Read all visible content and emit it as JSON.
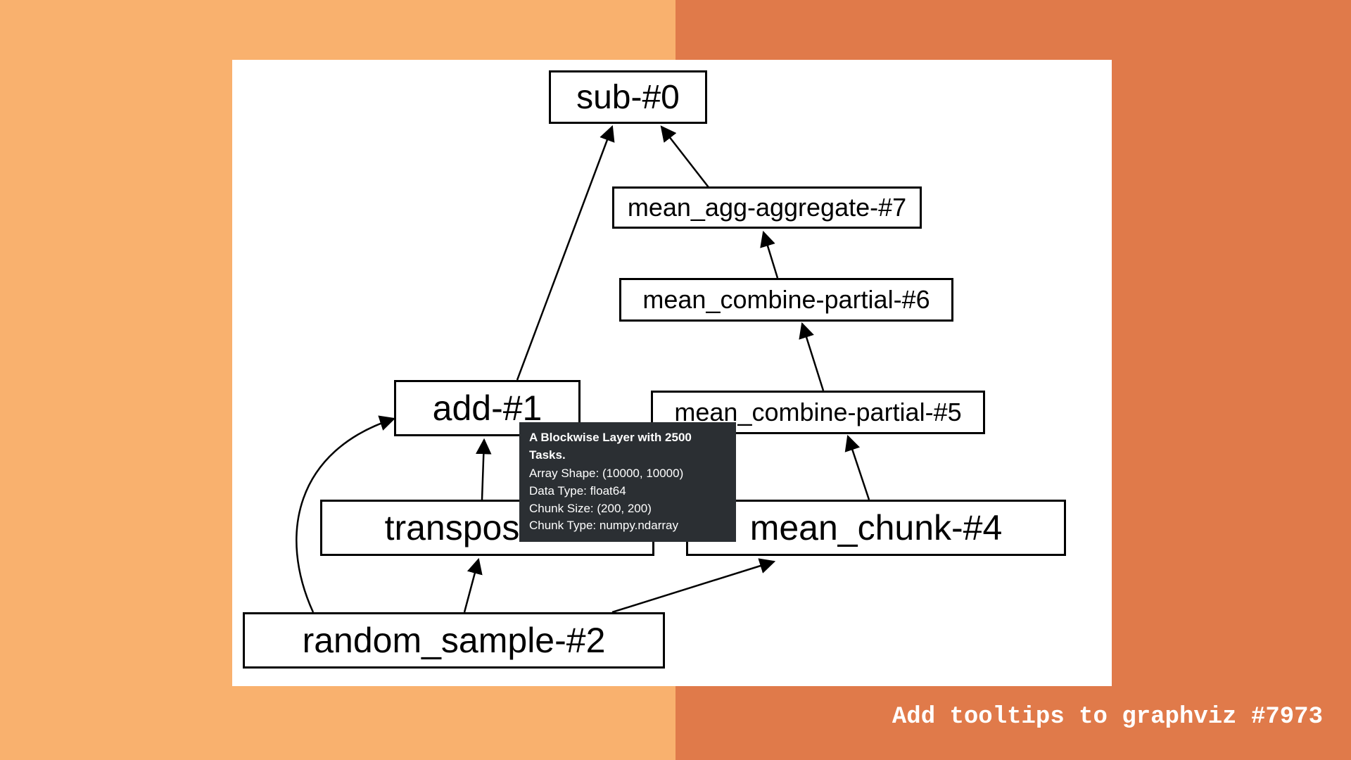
{
  "slide": {
    "background_left_color": "#f9b16e",
    "background_right_color": "#e07a4a",
    "caption": "Add tooltips to graphviz #7973"
  },
  "graph": {
    "nodes": {
      "sub": {
        "label": "sub-#0"
      },
      "aggregate": {
        "label": "mean_agg-aggregate-#7"
      },
      "partial6": {
        "label": "mean_combine-partial-#6"
      },
      "add": {
        "label": "add-#1"
      },
      "partial5": {
        "label": "mean_combine-partial-#5"
      },
      "transpose": {
        "label": "transpose-#3"
      },
      "chunk": {
        "label": "mean_chunk-#4"
      },
      "random": {
        "label": "random_sample-#2"
      }
    },
    "tooltip": {
      "title": "A Blockwise Layer with 2500 Tasks.",
      "lines": [
        "Array Shape: (10000, 10000)",
        "Data Type: float64",
        "Chunk Size: (200, 200)",
        "Chunk Type: numpy.ndarray"
      ]
    }
  }
}
